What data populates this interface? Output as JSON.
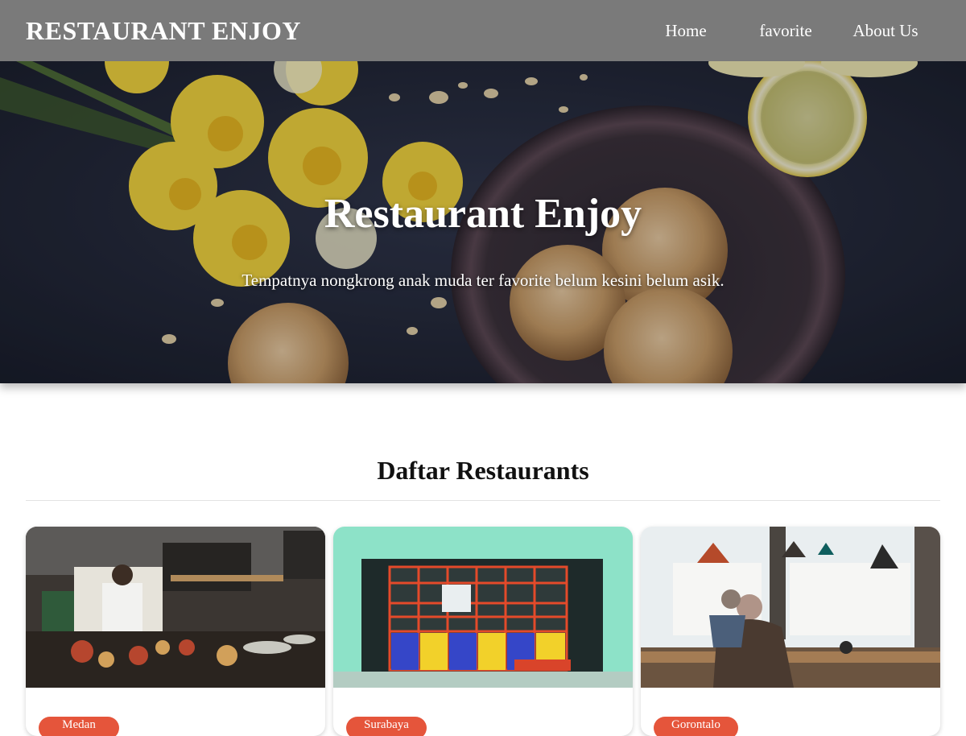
{
  "header": {
    "brand": "RESTAURANT ENJOY",
    "nav": [
      {
        "label": "Home"
      },
      {
        "label": "favorite"
      },
      {
        "label": "About Us"
      }
    ]
  },
  "hero": {
    "title": "Restaurant Enjoy",
    "tagline": "Tempatnya nongkrong anak muda ter favorite belum kesini belum asik."
  },
  "main": {
    "section_title": "Daftar Restaurants",
    "cards": [
      {
        "city": "Medan"
      },
      {
        "city": "Surabaya"
      },
      {
        "city": "Gorontalo"
      }
    ]
  },
  "colors": {
    "header_bg": "#7a7a7a",
    "badge": "#e5553b"
  }
}
